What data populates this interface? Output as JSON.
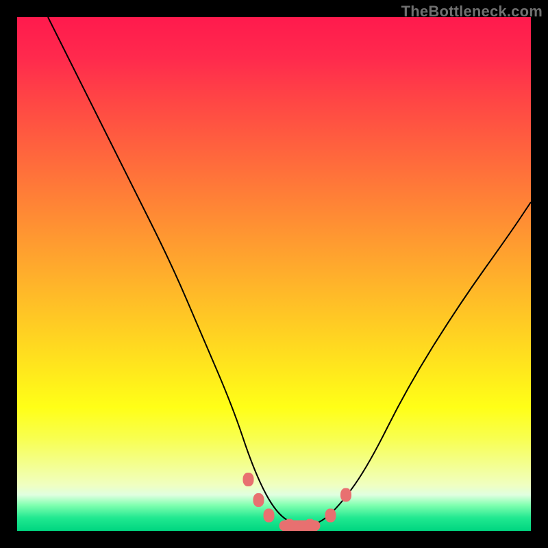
{
  "watermark": "TheBottleneck.com",
  "chart_data": {
    "type": "line",
    "title": "",
    "xlabel": "",
    "ylabel": "",
    "xlim": [
      0,
      100
    ],
    "ylim": [
      0,
      100
    ],
    "series": [
      {
        "name": "bottleneck-curve",
        "x": [
          6,
          14,
          22,
          30,
          36,
          42,
          46,
          50,
          54,
          58,
          62,
          68,
          76,
          86,
          96,
          100
        ],
        "values": [
          100,
          84,
          68,
          52,
          38,
          24,
          12,
          4,
          1,
          1,
          4,
          12,
          28,
          44,
          58,
          64
        ]
      }
    ],
    "markers": {
      "name": "flat-bottom-markers",
      "points": [
        {
          "x": 45,
          "y": 10
        },
        {
          "x": 47,
          "y": 6
        },
        {
          "x": 49,
          "y": 3
        },
        {
          "x": 53,
          "y": 1
        },
        {
          "x": 57,
          "y": 1
        },
        {
          "x": 61,
          "y": 3
        },
        {
          "x": 64,
          "y": 7
        }
      ]
    },
    "background_gradient": {
      "top_color": "#ff1a4d",
      "mid_color": "#ffff17",
      "bottom_color": "#00d680"
    }
  }
}
